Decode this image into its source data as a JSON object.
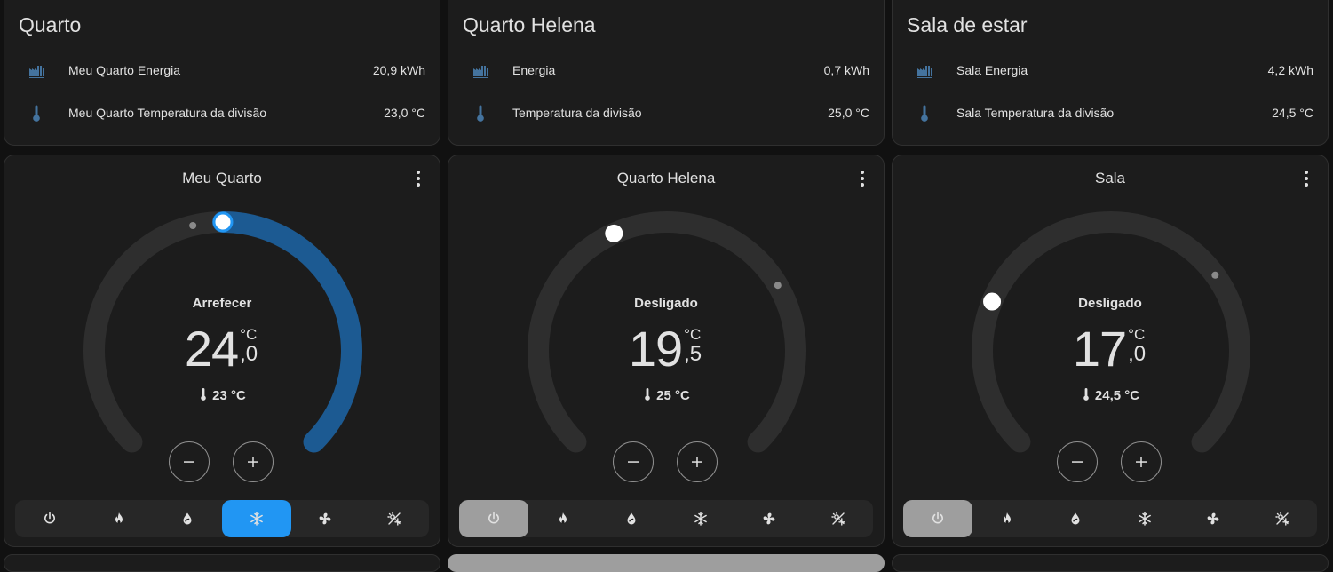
{
  "areas": [
    {
      "title": "Quarto",
      "rows": [
        {
          "name": "Meu Quarto Energia",
          "value": "20,9 kWh",
          "icon": "factory-icon"
        },
        {
          "name": "Meu Quarto Temperatura da divisão",
          "value": "23,0 °C",
          "icon": "thermometer-icon"
        }
      ]
    },
    {
      "title": "Quarto Helena",
      "rows": [
        {
          "name": "Energia",
          "value": "0,7 kWh",
          "icon": "factory-icon"
        },
        {
          "name": "Temperatura da divisão",
          "value": "25,0 °C",
          "icon": "thermometer-icon"
        }
      ]
    },
    {
      "title": "Sala de estar",
      "rows": [
        {
          "name": "Sala Energia",
          "value": "4,2 kWh",
          "icon": "factory-icon"
        },
        {
          "name": "Sala Temperatura da divisão",
          "value": "24,5 °C",
          "icon": "thermometer-icon"
        }
      ]
    }
  ],
  "thermostats": [
    {
      "name": "Meu Quarto",
      "mode": "Arrefecer",
      "target_int": "24",
      "target_dec": ",0",
      "unit": "°C",
      "target_fraction": 0.5,
      "current_fraction": 0.45,
      "active": true,
      "current": "23 °C",
      "active_mode": "cool"
    },
    {
      "name": "Quarto Helena",
      "mode": "Desligado",
      "target_int": "19",
      "target_dec": ",5",
      "unit": "°C",
      "target_fraction": 0.41,
      "current_fraction": 0.72,
      "active": false,
      "current": "25 °C",
      "active_mode": "off"
    },
    {
      "name": "Sala",
      "mode": "Desligado",
      "target_int": "17",
      "target_dec": ",0",
      "unit": "°C",
      "target_fraction": 0.25,
      "current_fraction": 0.7,
      "active": false,
      "current": "24,5 °C",
      "active_mode": "off"
    }
  ],
  "hvac_modes": [
    {
      "key": "off",
      "icon": "power-icon"
    },
    {
      "key": "heat",
      "icon": "flame-icon"
    },
    {
      "key": "dry",
      "icon": "water-drop-icon"
    },
    {
      "key": "cool",
      "icon": "snowflake-icon"
    },
    {
      "key": "fan_only",
      "icon": "fan-icon"
    },
    {
      "key": "auto",
      "icon": "sun-snowflake-icon"
    }
  ],
  "colors": {
    "accent": "#2196f3",
    "cool_arc": "#1c5a92",
    "off_active": "#9e9e9e",
    "track": "#2e2e2e",
    "icon_blue": "#44739e",
    "card_bg": "#1c1c1c"
  }
}
